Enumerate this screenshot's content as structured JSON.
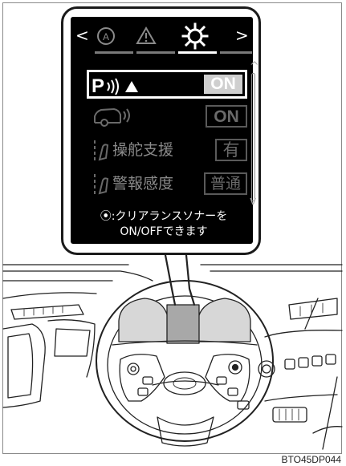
{
  "header": {
    "prev_glyph": "<",
    "next_glyph": ">",
    "tabs": [
      {
        "icon": "cruise-a-icon",
        "active": false
      },
      {
        "icon": "warning-triangle-icon",
        "active": false
      },
      {
        "icon": "gear-icon",
        "active": true
      }
    ]
  },
  "rows": [
    {
      "icon": "parking-sonar-icon",
      "icon_text": "P",
      "value": "ON",
      "selected": true
    },
    {
      "icon": "vehicle-sensor-icon",
      "value": "ON",
      "selected": false
    },
    {
      "icon": "steering-assist-icon",
      "label": "操舵支援",
      "value": "有",
      "selected": false
    },
    {
      "icon": "alert-sensitivity-icon",
      "label": "警報感度",
      "value": "普通",
      "selected": false
    }
  ],
  "hint": {
    "line1": "⦿:クリアランスソナーを",
    "line2": "ON/OFFできます"
  },
  "figure_code": "BTO45DP044",
  "colors": {
    "screen": "#000000",
    "selected_box": "#cfcfcf",
    "dim_text": "#8a8a8a"
  }
}
